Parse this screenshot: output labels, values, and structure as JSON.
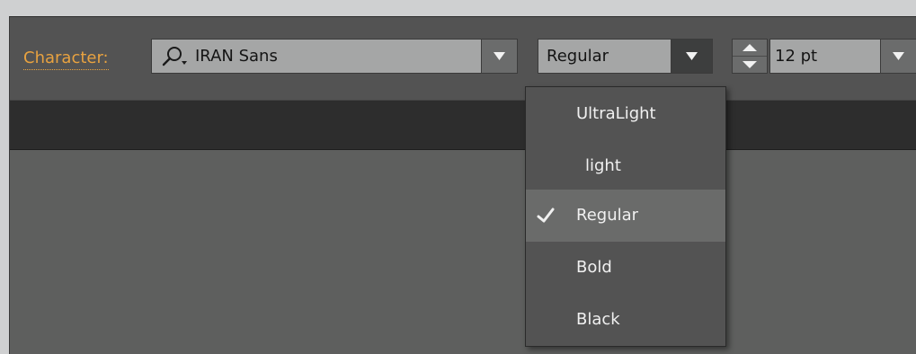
{
  "control_bar": {
    "label": "Character:",
    "font_family": {
      "value": "IRAN Sans",
      "icon": "search-icon"
    },
    "font_style": {
      "value": "Regular"
    },
    "font_size": {
      "value": "12 pt"
    }
  },
  "style_menu": {
    "items": [
      {
        "label": "UltraLight",
        "selected": false
      },
      {
        "label": "light",
        "selected": false
      },
      {
        "label": "Regular",
        "selected": true
      },
      {
        "label": "Bold",
        "selected": false
      },
      {
        "label": "Black",
        "selected": false
      }
    ]
  },
  "colors": {
    "accent_label": "#e8a240",
    "panel": "#535353",
    "field": "#a5a6a6",
    "selected_row": "#6a6b6a"
  }
}
